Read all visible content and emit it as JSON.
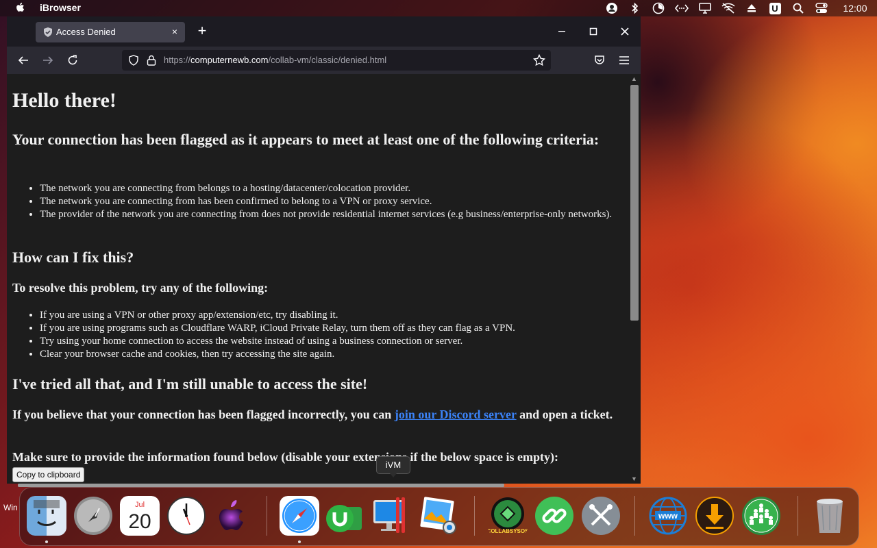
{
  "menubar": {
    "app_name": "iBrowser",
    "time": "12:00",
    "tray_icons": [
      "account-icon",
      "bluetooth-icon",
      "timer-icon",
      "remote-icon",
      "display-icon",
      "wifi-off-icon",
      "eject-icon",
      "u-icon",
      "search-icon",
      "control-center-icon"
    ],
    "u_label": "U"
  },
  "desktop": {
    "partial_text_win": "Win"
  },
  "browser": {
    "tab_title": "Access Denied",
    "tab_close": "×",
    "new_tab": "+",
    "url_host": "computernewb.com",
    "url_prefix": "https://",
    "url_path": "/collab-vm/classic/denied.html"
  },
  "page": {
    "hello": "Hello there!",
    "flagged_heading": "Your connection has been flagged as it appears to meet at least one of the following criteria:",
    "criteria": [
      "The network you are connecting from belongs to a hosting/datacenter/colocation provider.",
      "The network you are connecting from has been confirmed to belong to a VPN or proxy service.",
      "The provider of the network you are connecting from does not provide residential internet services (e.g business/enterprise-only networks)."
    ],
    "fix_heading": "How can I fix this?",
    "resolve_heading": "To resolve this problem, try any of the following:",
    "fixes": [
      "If you are using a VPN or other proxy app/extension/etc, try disabling it.",
      "If you are using programs such as Cloudflare WARP, iCloud Private Relay, turn them off as they can flag as a VPN.",
      "Try using your home connection to access the website instead of using a business connection or server.",
      "Clear your browser cache and cookies, then try accessing the site again."
    ],
    "tried_heading": "I've tried all that, and I'm still unable to access the site!",
    "incorrect_prefix": "If you believe that your connection has been flagged incorrectly, you can ",
    "discord_link": "join our Discord server",
    "incorrect_suffix": " and open a ticket.",
    "provide_info": "Make sure to provide the information found below (disable your extensions if the below space is empty):",
    "copy_button": "Copy to clipboard"
  },
  "dock": {
    "tooltip": "iVM",
    "calendar_month": "Jul",
    "calendar_day": "20",
    "collabsysos_label": "COLLABSYSOS",
    "www_label": "www",
    "items": [
      "finder",
      "launchpad",
      "calendar",
      "clock",
      "macos",
      "safari",
      "utorrent",
      "ivm",
      "photos",
      "collabsysos",
      "link",
      "utilities",
      "www-browser",
      "downloader",
      "community",
      "trash"
    ]
  },
  "colors": {
    "accent_link": "#3b82f6",
    "page_bg": "#1d1d1d",
    "browser_chrome": "#2b2a33"
  }
}
